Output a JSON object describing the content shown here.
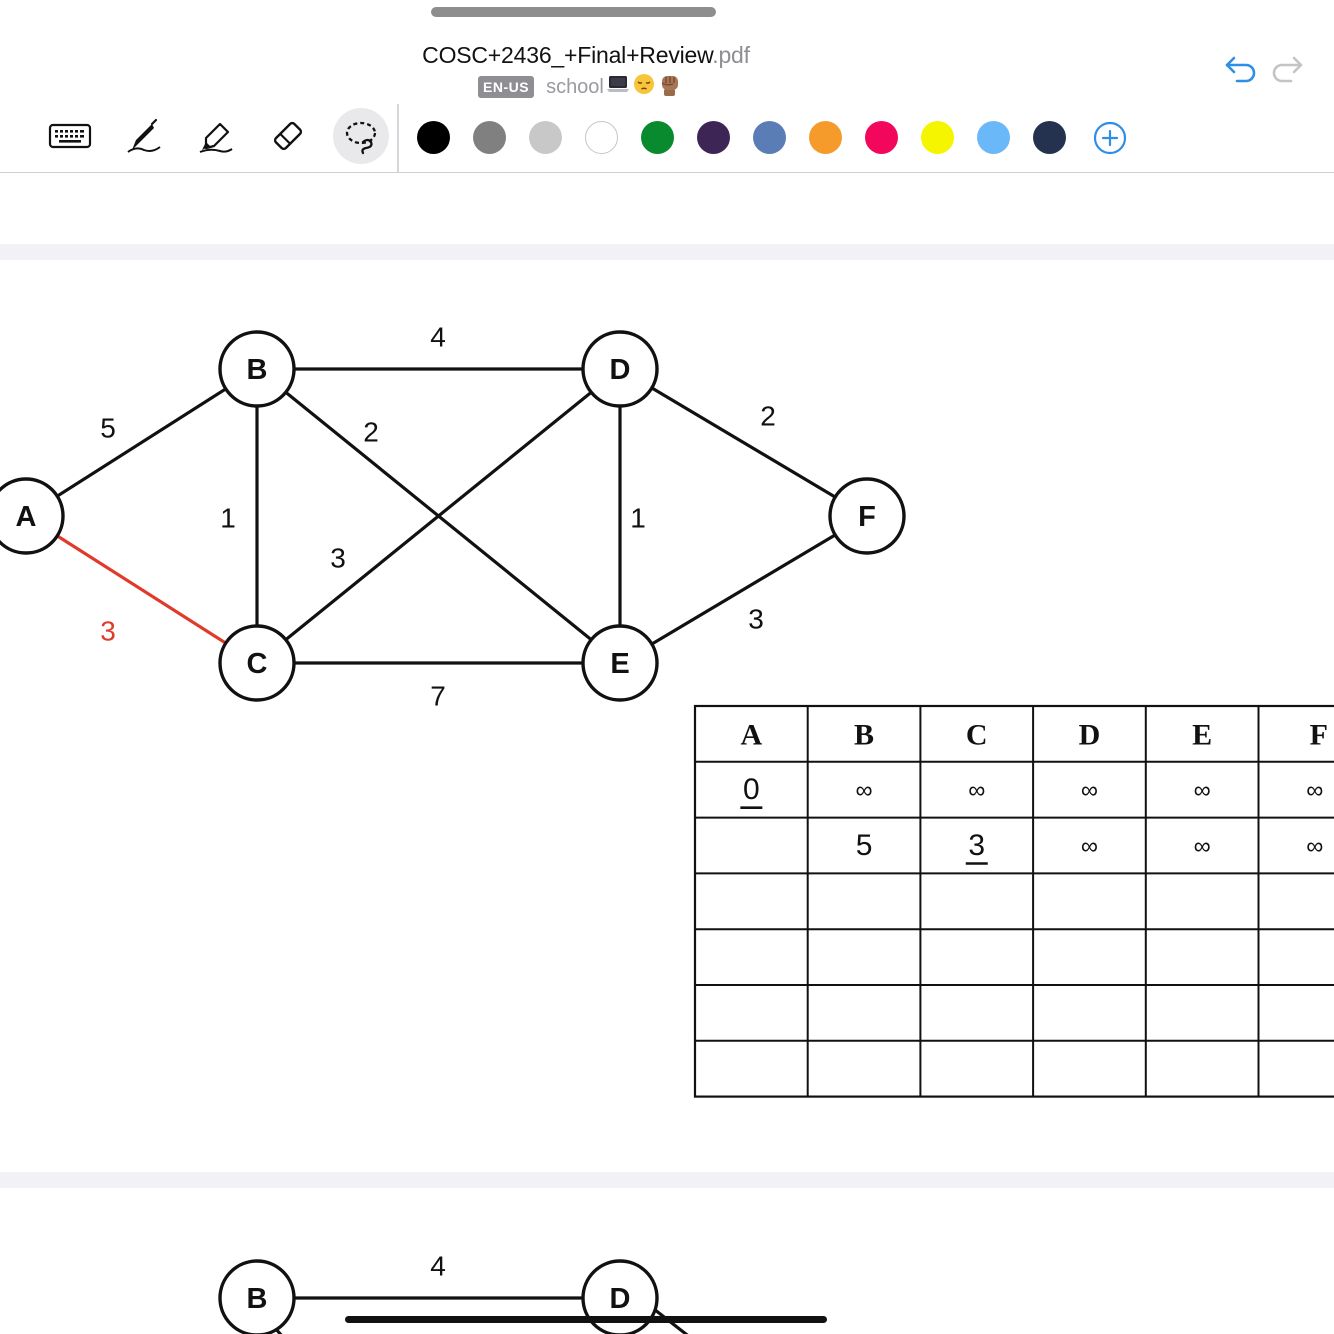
{
  "document": {
    "title_name": "COSC+2436_+Final+Review",
    "title_ext": ".pdf",
    "language_badge": "EN-US",
    "folder_name": "school",
    "folder_emojis": [
      "laptop-emoji",
      "pensive-face-emoji",
      "raised-fist-emoji"
    ]
  },
  "toolbar": {
    "tools": [
      {
        "name": "keyboard-icon",
        "selected": false
      },
      {
        "name": "pen-icon",
        "selected": false
      },
      {
        "name": "highlighter-icon",
        "selected": false
      },
      {
        "name": "eraser-icon",
        "selected": false
      },
      {
        "name": "lasso-icon",
        "selected": true
      }
    ],
    "colors": [
      "#000000",
      "#808080",
      "#c8c8c8",
      "#ffffff",
      "#0a8a2e",
      "#3d2656",
      "#5a7db6",
      "#f59b2c",
      "#f3075c",
      "#f5f500",
      "#6ab8f7",
      "#24314f"
    ],
    "add_color_icon": "plus-circle-icon",
    "undo_icon": "undo-icon",
    "redo_icon": "redo-icon"
  },
  "graph1": {
    "nodes": [
      {
        "id": "A",
        "label": "A"
      },
      {
        "id": "B",
        "label": "B"
      },
      {
        "id": "C",
        "label": "C"
      },
      {
        "id": "D",
        "label": "D"
      },
      {
        "id": "E",
        "label": "E"
      },
      {
        "id": "F",
        "label": "F"
      }
    ],
    "edges": [
      {
        "from": "A",
        "to": "B",
        "weight": "5",
        "highlighted": false
      },
      {
        "from": "A",
        "to": "C",
        "weight": "3",
        "highlighted": true
      },
      {
        "from": "B",
        "to": "C",
        "weight": "1",
        "highlighted": false
      },
      {
        "from": "B",
        "to": "D",
        "weight": "4",
        "highlighted": false
      },
      {
        "from": "B",
        "to": "E",
        "weight": "2",
        "highlighted": false
      },
      {
        "from": "C",
        "to": "D",
        "weight": "3",
        "highlighted": false
      },
      {
        "from": "C",
        "to": "E",
        "weight": "7",
        "highlighted": false
      },
      {
        "from": "D",
        "to": "E",
        "weight": "1",
        "highlighted": false
      },
      {
        "from": "D",
        "to": "F",
        "weight": "2",
        "highlighted": false
      },
      {
        "from": "E",
        "to": "F",
        "weight": "3",
        "highlighted": false
      }
    ],
    "highlight_color": "#e03a2a"
  },
  "distance_table": {
    "headers": [
      "A",
      "B",
      "C",
      "D",
      "E",
      "F"
    ],
    "rows": [
      [
        {
          "v": "0",
          "u": true
        },
        {
          "v": "∞"
        },
        {
          "v": "∞"
        },
        {
          "v": "∞"
        },
        {
          "v": "∞"
        },
        {
          "v": "∞"
        }
      ],
      [
        {
          "v": ""
        },
        {
          "v": "5"
        },
        {
          "v": "3",
          "u": true
        },
        {
          "v": "∞"
        },
        {
          "v": "∞"
        },
        {
          "v": "∞"
        }
      ],
      [
        {
          "v": ""
        },
        {
          "v": ""
        },
        {
          "v": ""
        },
        {
          "v": ""
        },
        {
          "v": ""
        },
        {
          "v": ""
        }
      ],
      [
        {
          "v": ""
        },
        {
          "v": ""
        },
        {
          "v": ""
        },
        {
          "v": ""
        },
        {
          "v": ""
        },
        {
          "v": ""
        }
      ],
      [
        {
          "v": ""
        },
        {
          "v": ""
        },
        {
          "v": ""
        },
        {
          "v": ""
        },
        {
          "v": ""
        },
        {
          "v": ""
        }
      ],
      [
        {
          "v": ""
        },
        {
          "v": ""
        },
        {
          "v": ""
        },
        {
          "v": ""
        },
        {
          "v": ""
        },
        {
          "v": ""
        }
      ]
    ]
  },
  "graph2_partial": {
    "nodes": [
      {
        "id": "B",
        "label": "B"
      },
      {
        "id": "D",
        "label": "D"
      }
    ],
    "edges": [
      {
        "from": "B",
        "to": "D",
        "weight": "4"
      }
    ]
  }
}
